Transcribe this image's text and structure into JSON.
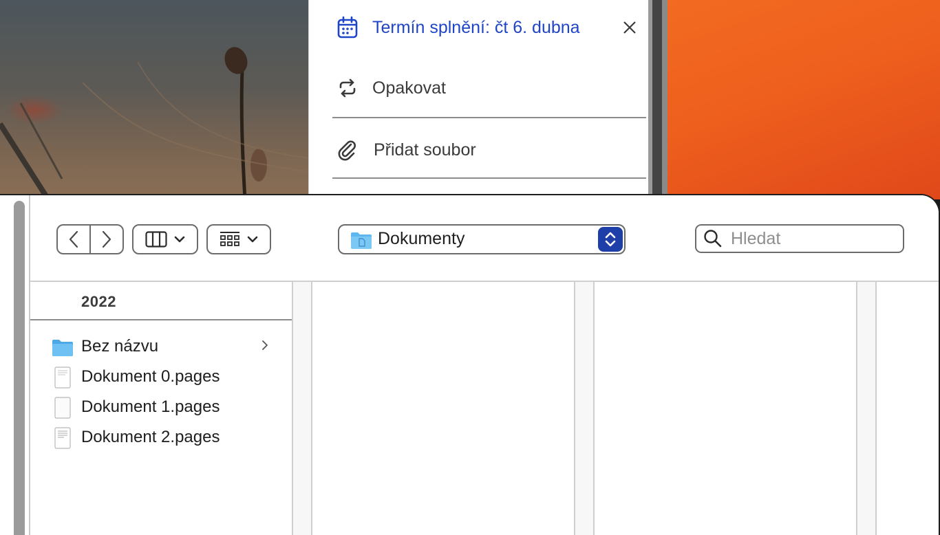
{
  "reminder": {
    "due_date_label": "Termín splnění: čt 6. dubna",
    "repeat_label": "Opakovat",
    "attach_label": "Přidat soubor"
  },
  "dialog": {
    "location": "Dokumenty",
    "search_placeholder": "Hledat",
    "column_header": "2022",
    "files": [
      {
        "name": "Bez názvu",
        "kind": "folder",
        "has_children": true
      },
      {
        "name": "Dokument 0.pages",
        "kind": "document"
      },
      {
        "name": "Dokument 1.pages",
        "kind": "document-blank"
      },
      {
        "name": "Dokument 2.pages",
        "kind": "document"
      }
    ]
  },
  "colors": {
    "accent_blue": "#1f45c7",
    "stepper_blue": "#1e3ea8",
    "folder_blue": "#5fb7ef",
    "orange_bg": "#ee5f1d"
  },
  "icons": {
    "due_date": "calendar-icon",
    "repeat": "repeat-icon",
    "attach": "paperclip-icon",
    "close": "close-icon",
    "back": "chevron-left-icon",
    "forward": "chevron-right-icon",
    "view": "column-view-icon",
    "group": "grid-icon",
    "search": "search-icon"
  }
}
